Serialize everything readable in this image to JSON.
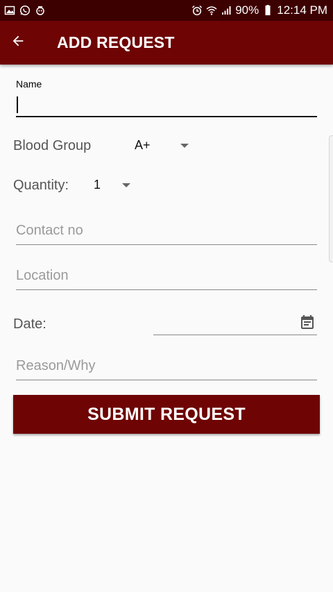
{
  "status_bar": {
    "battery": "90%",
    "time": "12:14 PM",
    "icons_left": [
      "gallery-icon",
      "whatsapp-icon",
      "notification-icon"
    ],
    "icons_right": [
      "alarm-icon",
      "wifi-icon",
      "signal-icon",
      "battery-icon"
    ]
  },
  "app_bar": {
    "title": "ADD REQUEST",
    "back_icon": "arrow-left-icon",
    "color": "#6e0404"
  },
  "form": {
    "name_label": "Name",
    "name_value": "",
    "blood_group_label": "Blood Group",
    "blood_group_value": "A+",
    "quantity_label": "Quantity:",
    "quantity_value": "1",
    "contact_placeholder": "Contact no",
    "location_placeholder": "Location",
    "date_label": "Date:",
    "date_icon": "calendar-icon",
    "reason_placeholder": "Reason/Why",
    "submit_label": "SUBMIT REQUEST"
  }
}
